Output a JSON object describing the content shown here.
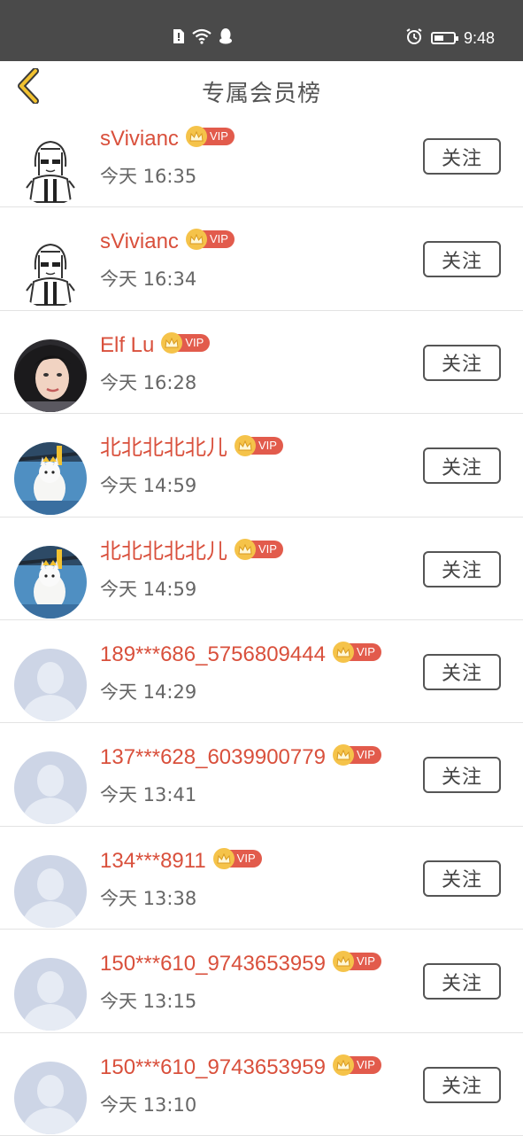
{
  "status_bar": {
    "time": "9:48",
    "icons": [
      "sim-alert-icon",
      "wifi-icon",
      "qq-icon",
      "alarm-icon",
      "battery-icon"
    ]
  },
  "header": {
    "title": "专属会员榜",
    "back_icon": "chevron-left-icon"
  },
  "colors": {
    "name": "#d9503c",
    "vip_tag": "#e25b4c",
    "vip_crown": "#f5c34a",
    "back_icon": "#f2c230",
    "statusbar": "#4a4a4a"
  },
  "vip_label": "VIP",
  "follow_label": "关注",
  "members": [
    {
      "name": "sVivianc",
      "time": "今天 16:35",
      "avatar": "cartoon-girl-avatar"
    },
    {
      "name": "sVivianc",
      "time": "今天 16:34",
      "avatar": "cartoon-girl-avatar"
    },
    {
      "name": "Elf Lu",
      "time": "今天 16:28",
      "avatar": "photo-woman-avatar"
    },
    {
      "name": "北北北北北儿",
      "time": "今天 14:59",
      "avatar": "photo-cat-avatar"
    },
    {
      "name": "北北北北北儿",
      "time": "今天 14:59",
      "avatar": "photo-cat-avatar"
    },
    {
      "name": "189***686_5756809444",
      "time": "今天 14:29",
      "avatar": "default-user-avatar"
    },
    {
      "name": "137***628_6039900779",
      "time": "今天 13:41",
      "avatar": "default-user-avatar"
    },
    {
      "name": "134***8911",
      "time": "今天 13:38",
      "avatar": "default-user-avatar"
    },
    {
      "name": "150***610_9743653959",
      "time": "今天 13:15",
      "avatar": "default-user-avatar"
    },
    {
      "name": "150***610_9743653959",
      "time": "今天 13:10",
      "avatar": "default-user-avatar"
    }
  ]
}
